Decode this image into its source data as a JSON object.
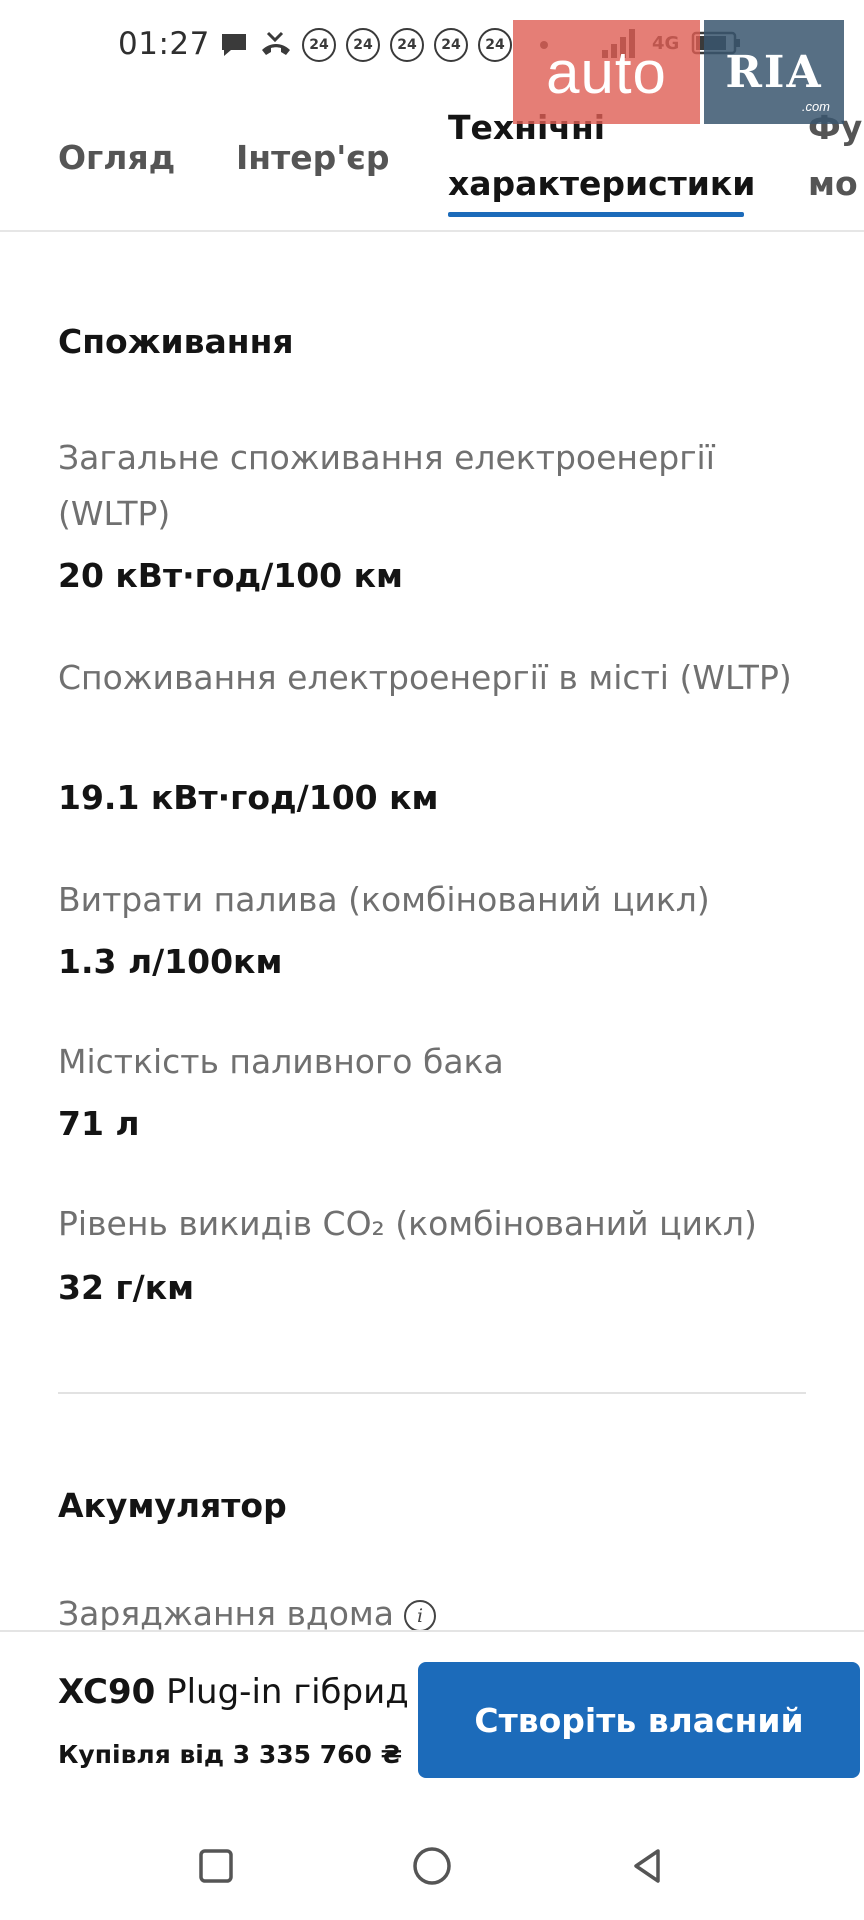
{
  "status_bar": {
    "time": "01:27",
    "badges": [
      "24",
      "24",
      "24",
      "24",
      "24"
    ],
    "network": "4G"
  },
  "watermark": {
    "left": "auto",
    "right": "RIA",
    "suffix": ".com"
  },
  "tabs": [
    {
      "label": "Огляд"
    },
    {
      "label": "Інтер'єр"
    },
    {
      "label_line1": "Технічні",
      "label_line2": "характеристики"
    },
    {
      "label_line1": "Фу",
      "label_line2": "мо"
    }
  ],
  "sections": {
    "consumption": {
      "title": "Споживання",
      "specs": [
        {
          "label": "Загальне споживання електроенергії (WLTP)",
          "value": "20 кВт·год/100 км"
        },
        {
          "label": "Споживання електроенергії в місті (WLTP)",
          "value": "19.1 кВт·год/100 км"
        },
        {
          "label": "Витрати палива (комбінований цикл)",
          "value": "1.3 л/100км"
        },
        {
          "label": "Місткість паливного бака",
          "value": "71 л"
        },
        {
          "label": "Рівень викидів CO₂ (комбінований цикл)",
          "value": "32 г/км"
        }
      ]
    },
    "battery": {
      "title": "Акумулятор",
      "specs": [
        {
          "label": "Заряджання вдома"
        }
      ]
    }
  },
  "bottom_bar": {
    "model_name": "XC90",
    "model_variant": "Plug-in гібрид",
    "price": "Купівля від 3 335 760 ₴",
    "cta_label": "Створіть власний"
  },
  "colors": {
    "accent": "#1c6bba",
    "label_gray": "#707070",
    "text_dark": "#141414"
  }
}
